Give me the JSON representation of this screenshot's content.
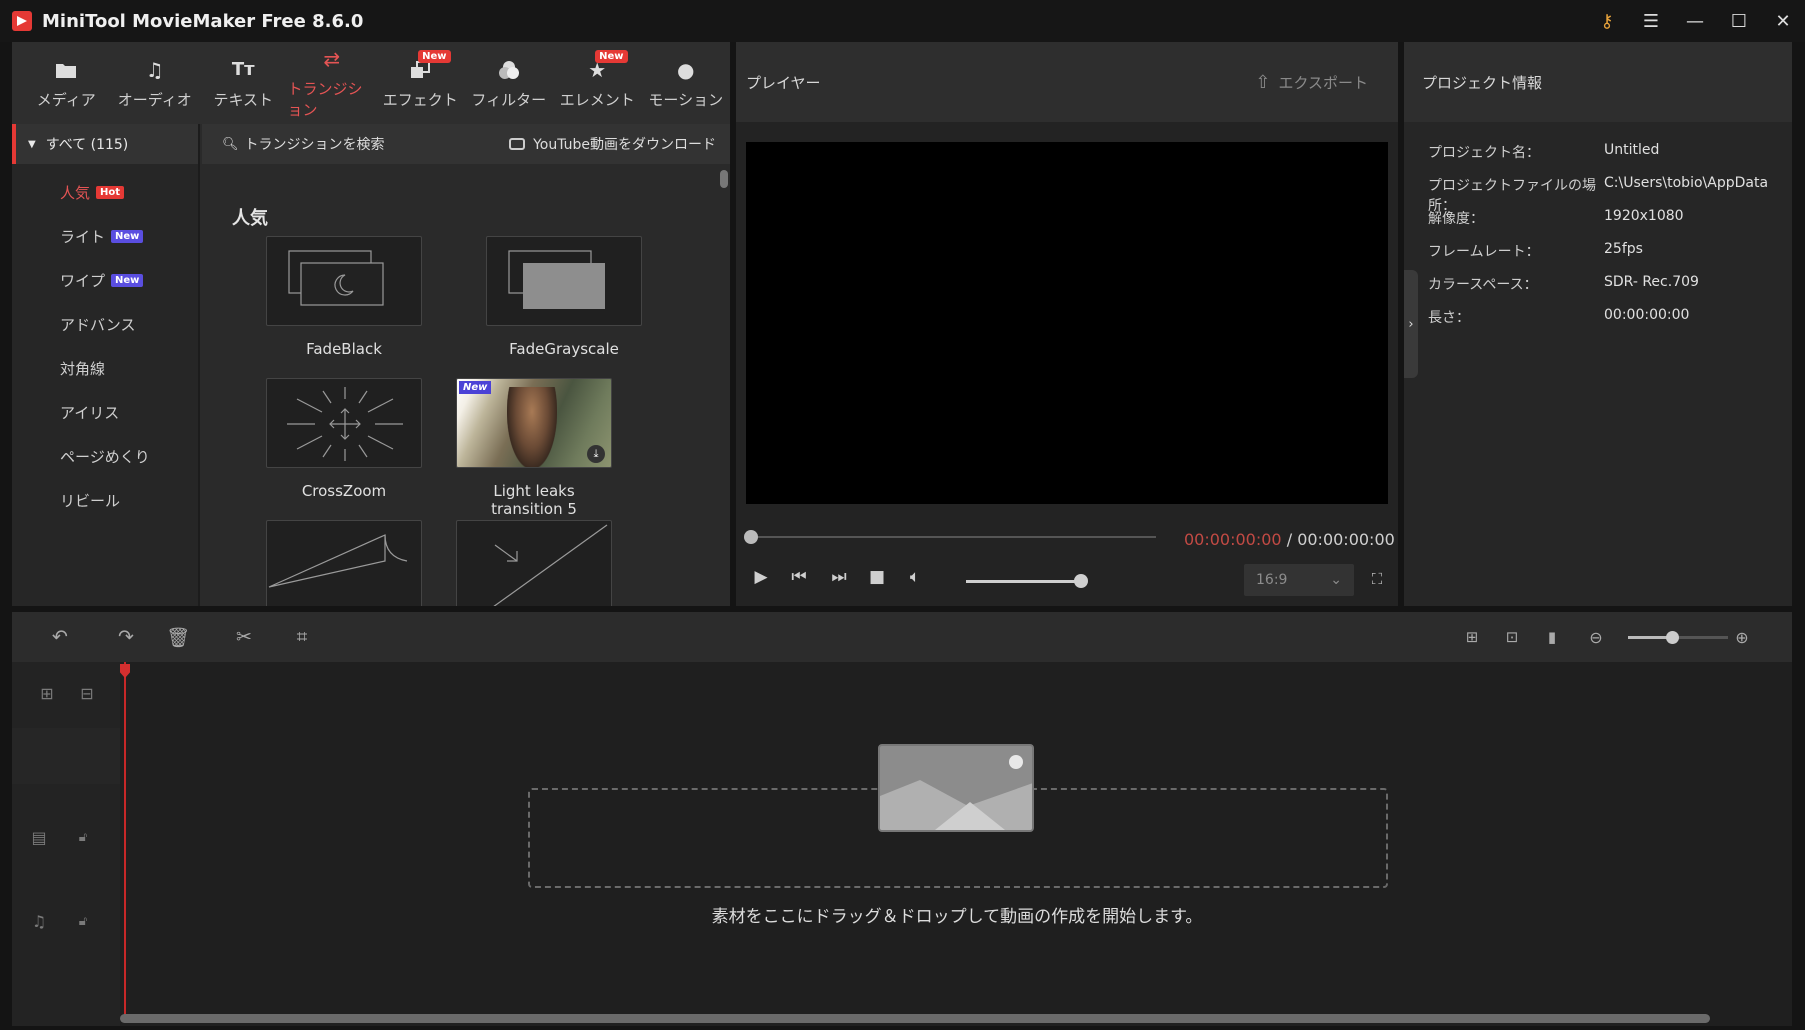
{
  "app": {
    "title": "MiniTool MovieMaker Free 8.6.0"
  },
  "window_controls": [
    "key-icon",
    "menu-icon",
    "minimize-icon",
    "maximize-icon",
    "close-icon"
  ],
  "library": {
    "tabs": [
      {
        "label": "メディア",
        "icon": "folder-icon"
      },
      {
        "label": "オーディオ",
        "icon": "music-icon"
      },
      {
        "label": "テキスト",
        "icon": "text-icon"
      },
      {
        "label": "トランジション",
        "icon": "transition-icon",
        "active": true
      },
      {
        "label": "エフェクト",
        "icon": "effect-icon",
        "badge": "New"
      },
      {
        "label": "フィルター",
        "icon": "filter-icon"
      },
      {
        "label": "エレメント",
        "icon": "element-icon",
        "badge": "New"
      },
      {
        "label": "モーション",
        "icon": "motion-icon"
      }
    ],
    "category_all": "すべて (115)",
    "categories": [
      {
        "label": "人気",
        "badge": "Hot"
      },
      {
        "label": "ライト",
        "badge": "New"
      },
      {
        "label": "ワイプ",
        "badge": "New"
      },
      {
        "label": "アドバンス"
      },
      {
        "label": "対角線"
      },
      {
        "label": "アイリス"
      },
      {
        "label": "ページめくり"
      },
      {
        "label": "リビール"
      }
    ],
    "search_placeholder": "トランジションを検索",
    "youtube_download": "YouTube動画をダウンロード",
    "section_title": "人気",
    "tiles": [
      {
        "label": "FadeBlack"
      },
      {
        "label": "FadeGrayscale"
      },
      {
        "label": "CrossZoom"
      },
      {
        "label": "Light leaks transition 5",
        "tag": "New"
      },
      {
        "label": ""
      },
      {
        "label": ""
      }
    ]
  },
  "player": {
    "title": "プレイヤー",
    "export_label": "エクスポート",
    "current_time": "00:00:00:00",
    "separator": "/",
    "total_time": "00:00:00:00",
    "aspect_ratio": "16:9"
  },
  "project_info": {
    "title": "プロジェクト情報",
    "rows": [
      {
        "key": "プロジェクト名：",
        "value": "Untitled"
      },
      {
        "key": "プロジェクトファイルの場所：",
        "value": "C:\\Users\\tobio\\AppData\\L"
      },
      {
        "key": "解像度：",
        "value": "1920x1080"
      },
      {
        "key": "フレームレート：",
        "value": "25fps"
      },
      {
        "key": "カラースペース：",
        "value": "SDR- Rec.709"
      },
      {
        "key": "長さ：",
        "value": "00:00:00:00"
      }
    ]
  },
  "timeline": {
    "drop_hint": "素材をここにドラッグ＆ドロップして動画の作成を開始します。"
  },
  "colors": {
    "accent": "#e53935",
    "active_text": "#e45454",
    "timecode_current": "#c24a44",
    "new_badge": "#5a4ee0"
  }
}
